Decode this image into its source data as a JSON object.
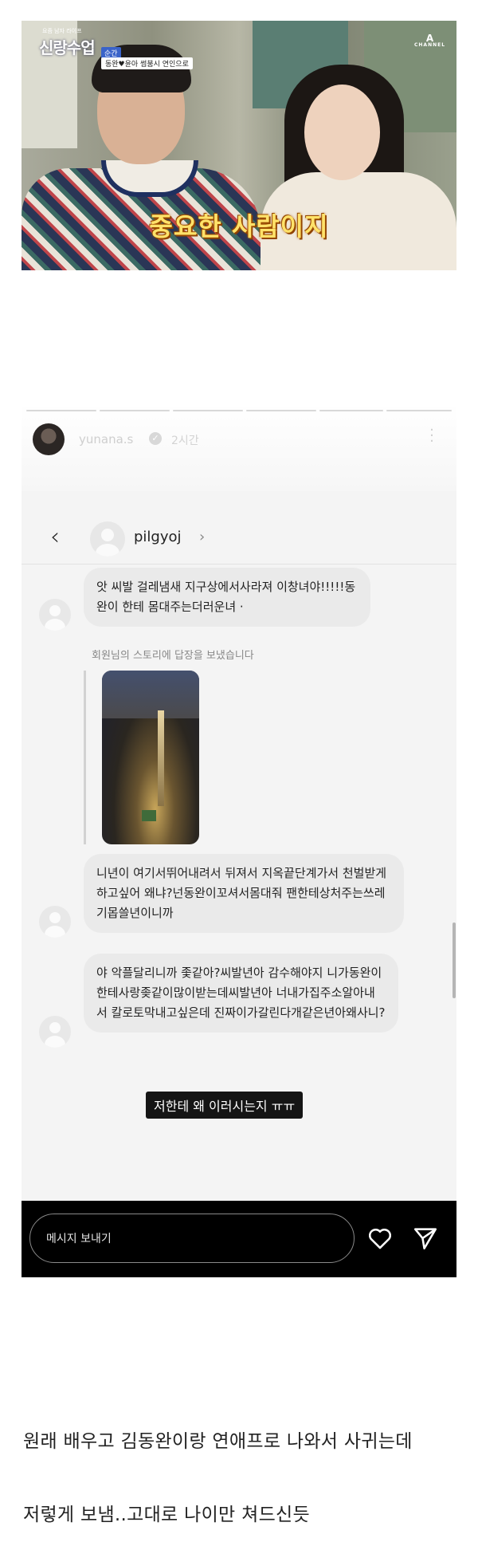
{
  "tv_still": {
    "show_logo": "신랑수업",
    "show_logo_sub": "요즘 남자 라이프",
    "episode_tag": "순간",
    "top_caption": "동완♥윤아 썸붐시 연인으로",
    "channel_logo": "A",
    "channel_name": "CHANNEL",
    "subtitle": "중요한 사람이지"
  },
  "story": {
    "username": "yunana.s",
    "verified_icon": "verified-check-icon",
    "time_ago": "2시간",
    "more_icon": "more-vertical-icon",
    "dm": {
      "back_icon": "back-chevron-icon",
      "username": "pilgyoj",
      "chevron": "›",
      "messages": [
        "앗 씨발 걸레냄새 지구상에서사라져 이창녀야!!!!!동완이 한테 몸대주는더러운녀 ·",
        "니년이 여기서뛰어내려서 뒤져서 지옥끝단계가서 천벌받게하고싶어 왜냐?넌동완이꼬셔서몸대줘 팬한테상처주는쓰레기몹쓸년이니까",
        "야 악플달리니까 좇같아?씨발년아 감수해야지 니가동완이한테사랑좆같이많이받는데씨발년아 너내가집주소알아내서 칼로토막내고싶은데 진짜이가갈린다개같은년아왜사니?"
      ],
      "reply_note": "회원님의 스토리에 답장을 보냈습니다"
    },
    "caption": "저한테 왜 이러시는지 ㅠㅠ",
    "send_placeholder": "메시지 보내기",
    "heart_icon": "heart-icon",
    "send_icon": "send-icon"
  },
  "post": {
    "line1": "원래 배우고 김동완이랑 연애프로 나와서 사귀는데",
    "line2": "저렇게 보냄..고대로 나이만 쳐드신듯"
  }
}
